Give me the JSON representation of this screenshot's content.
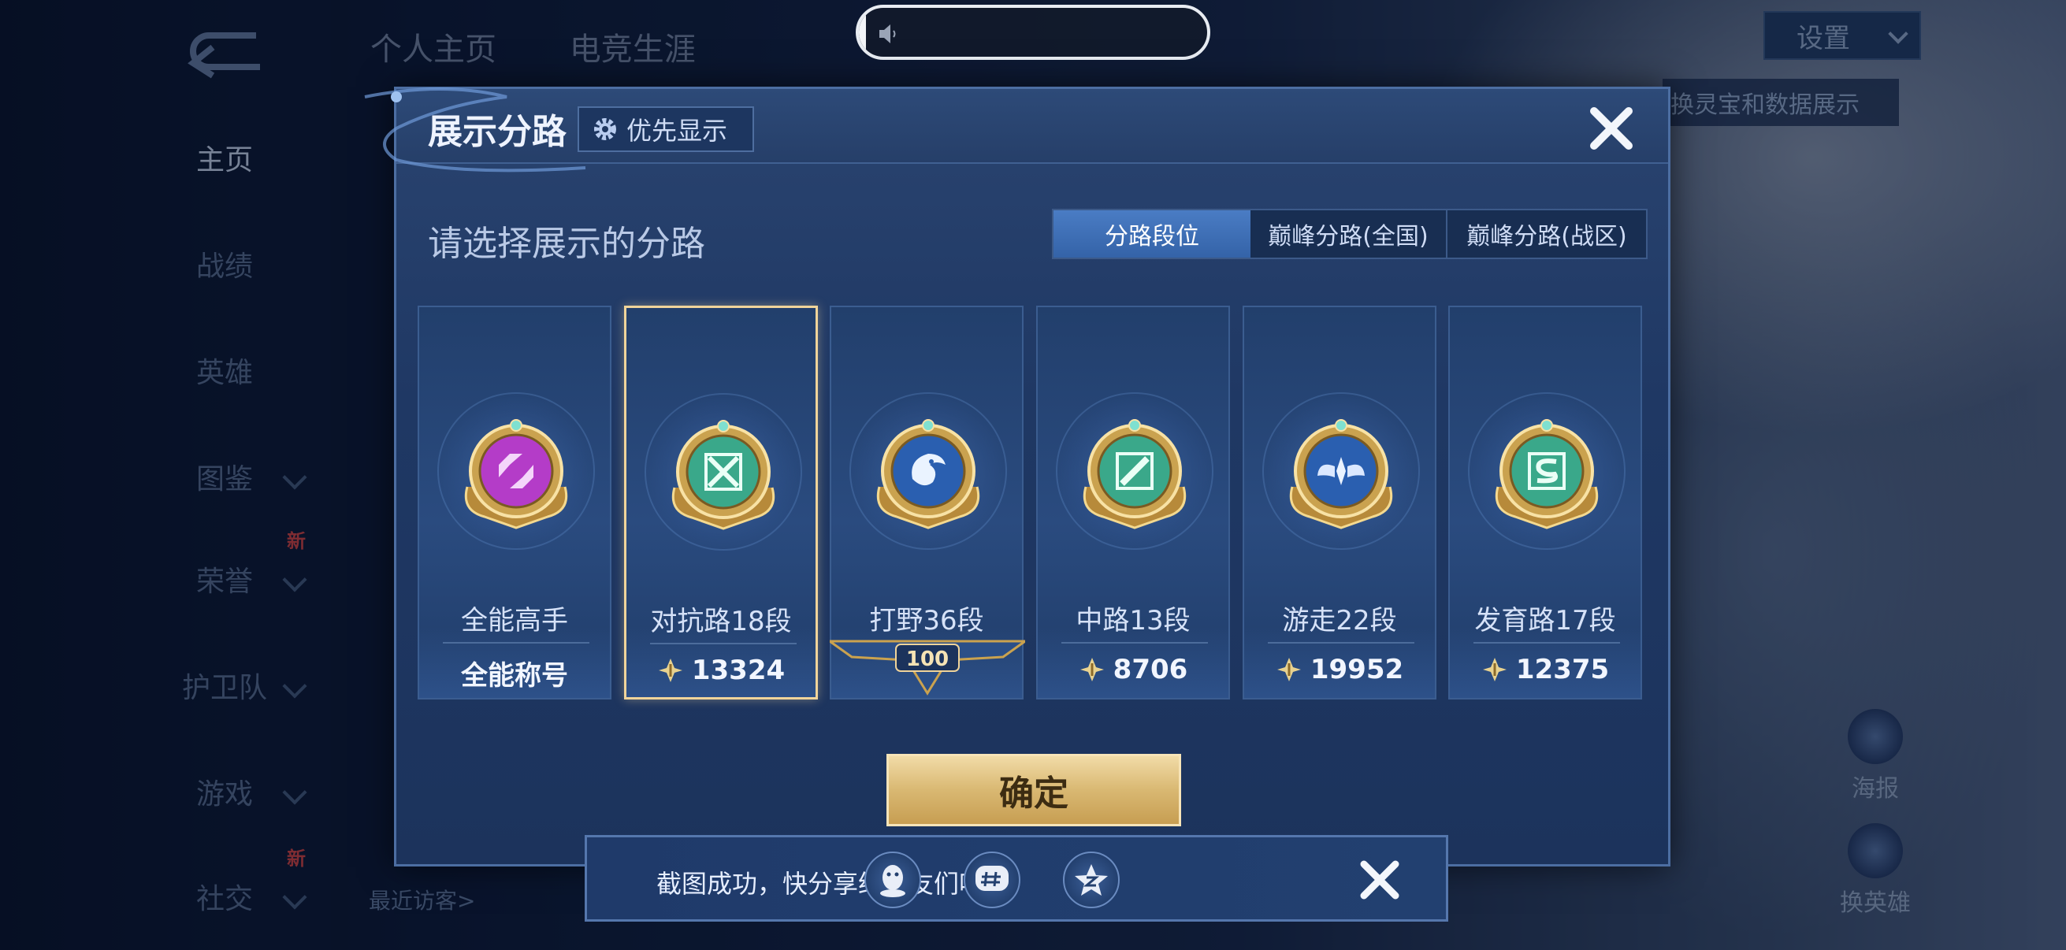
{
  "top_tabs": [
    "个人主页",
    "电竞生涯"
  ],
  "left_nav": {
    "items": [
      {
        "label": "主页",
        "active": true,
        "chevron": false,
        "new": false
      },
      {
        "label": "战绩",
        "active": false,
        "chevron": false,
        "new": false
      },
      {
        "label": "英雄",
        "active": false,
        "chevron": false,
        "new": false
      },
      {
        "label": "图鉴",
        "active": false,
        "chevron": true,
        "new": false
      },
      {
        "label": "荣誉",
        "active": false,
        "chevron": true,
        "new": true
      },
      {
        "label": "护卫队",
        "active": false,
        "chevron": true,
        "new": false
      },
      {
        "label": "游戏",
        "active": false,
        "chevron": true,
        "new": false
      },
      {
        "label": "社交",
        "active": false,
        "chevron": true,
        "new": true
      }
    ],
    "new_tag": "新"
  },
  "volume": {
    "level": 0.02
  },
  "settings_label": "设置",
  "background_banner": "换灵宝和数据展示",
  "right_buttons": [
    {
      "label": "海报",
      "icon": "poster-icon"
    },
    {
      "label": "换英雄",
      "icon": "swap-hero-icon"
    }
  ],
  "background_texts": {
    "visitors": "最近访客>"
  },
  "modal": {
    "title": "展示分路",
    "priority_label": "优先显示",
    "subtitle": "请选择展示的分路",
    "tabs": [
      "分路段位",
      "巅峰分路(全国)",
      "巅峰分路(战区)"
    ],
    "active_tab": 0,
    "lanes": [
      {
        "name": "全能高手",
        "score": "全能称号",
        "has_icon": false,
        "badge_color": "#b43cc8",
        "symbol": "allround",
        "selected": false
      },
      {
        "name": "对抗路18段",
        "score": "13324",
        "has_icon": true,
        "badge_color": "#3aa88a",
        "symbol": "cross",
        "selected": true
      },
      {
        "name": "打野36段",
        "score": "",
        "has_icon": false,
        "badge_color": "#2a5fb0",
        "symbol": "dragon",
        "selected": false,
        "level_badge": "100"
      },
      {
        "name": "中路13段",
        "score": "8706",
        "has_icon": true,
        "badge_color": "#3aa88a",
        "symbol": "slash",
        "selected": false
      },
      {
        "name": "游走22段",
        "score": "19952",
        "has_icon": true,
        "badge_color": "#2a5fb0",
        "symbol": "wings",
        "selected": false
      },
      {
        "name": "发育路17段",
        "score": "12375",
        "has_icon": true,
        "badge_color": "#3aa88a",
        "symbol": "s",
        "selected": false
      }
    ],
    "confirm_label": "确定"
  },
  "toast": {
    "message": "截图成功，快分享给朋友们吧!",
    "share_targets": [
      "qq-icon",
      "wechat-icon",
      "qzone-icon"
    ]
  }
}
